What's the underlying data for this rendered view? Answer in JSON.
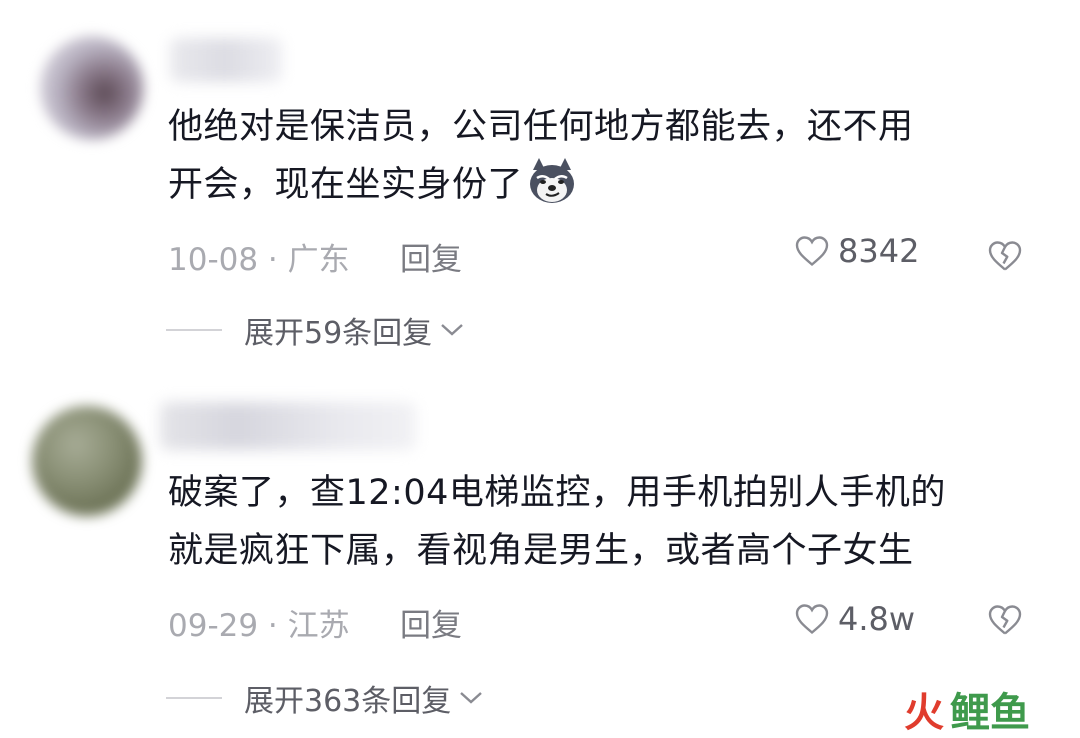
{
  "comments": [
    {
      "lines": [
        "他绝对是保洁员，公司任何地方都能去，还不用",
        "开会，现在坐实身份了"
      ],
      "has_emoji": true,
      "emoji": "husky-smirk-emoji",
      "meta": "10-08 · 广东",
      "reply_label": "回复",
      "likes": "8342",
      "expand_label": "展开59条回复"
    },
    {
      "lines": [
        "破案了，查12:04电梯监控，用手机拍别人手机的",
        "就是疯狂下属，看视角是男生，或者高个子女生"
      ],
      "has_emoji": false,
      "meta": "09-29 · 江苏",
      "reply_label": "回复",
      "likes": "4.8w",
      "expand_label": "展开363条回复"
    }
  ],
  "watermark": {
    "fire": "火",
    "fish": "鲤鱼"
  },
  "colors": {
    "text": "#161823",
    "meta": "#a9aab0",
    "secondary": "#5d5e66"
  }
}
